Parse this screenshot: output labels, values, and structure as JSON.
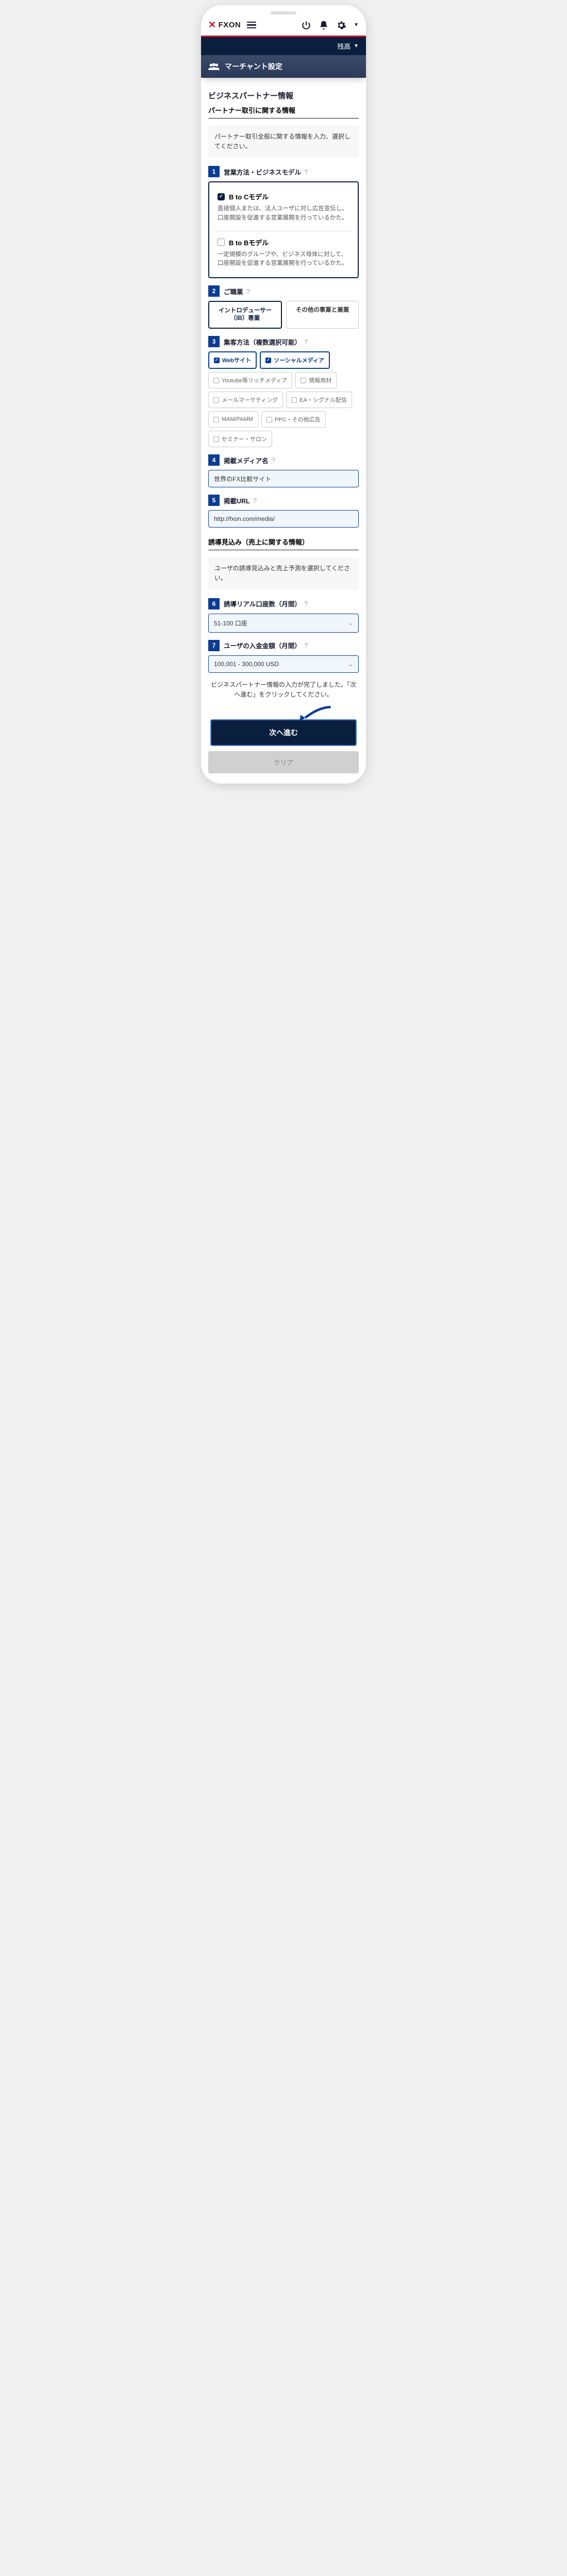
{
  "header": {
    "brand": "FXON",
    "balance_label": "残高"
  },
  "section": {
    "title": "マーチャント設定"
  },
  "page": {
    "h2": "ビジネスパートナー情報",
    "h3a": "パートナー取引に関する情報",
    "note_a": "パートナー取引全般に関する情報を入力、選択してください。",
    "h3b": "誘導見込み（売上に関する情報）",
    "note_b": "ユーザの誘導見込みと売上予測を選択してください。"
  },
  "fields": {
    "f1": {
      "label": "営業方法・ビジネスモデル",
      "opt1": {
        "title": "B to Cモデル",
        "desc": "直接個人または、法人ユーザに対し広告宣伝し、口座開設を促進する営業展開を行っているかた。"
      },
      "opt2": {
        "title": "B to Bモデル",
        "desc": "一定規模のグループや、ビジネス母体に対して、口座開設を促進する営業展開を行っているかた。"
      }
    },
    "f2": {
      "label": "ご職業",
      "opt1": "イントロデューサー（IB）専業",
      "opt2": "その他の事業と兼業"
    },
    "f3": {
      "label": "集客方法（複数選択可能）",
      "tags": [
        "Webサイト",
        "ソーシャルメディア",
        "Youtube等リッチメディア",
        "情報商材",
        "メールマーケティング",
        "EA・シグナル配信",
        "MAM/PAMM",
        "PPC・その他広告",
        "セミナー・サロン"
      ]
    },
    "f4": {
      "label": "掲載メディア名",
      "value": "世界のFX比較サイト"
    },
    "f5": {
      "label": "掲載URL",
      "value": "http://fxon.com/media/"
    },
    "f6": {
      "label": "誘導リアル口座数（月間）",
      "value": "51-100 口座"
    },
    "f7": {
      "label": "ユーザの入金金額（月間）",
      "value": "100,001 - 300,000 USD"
    }
  },
  "footer": {
    "note": "ビジネスパートナー情報の入力が完了しました。「次へ進む」をクリックしてください。",
    "primary": "次へ進む",
    "secondary": "クリア"
  }
}
